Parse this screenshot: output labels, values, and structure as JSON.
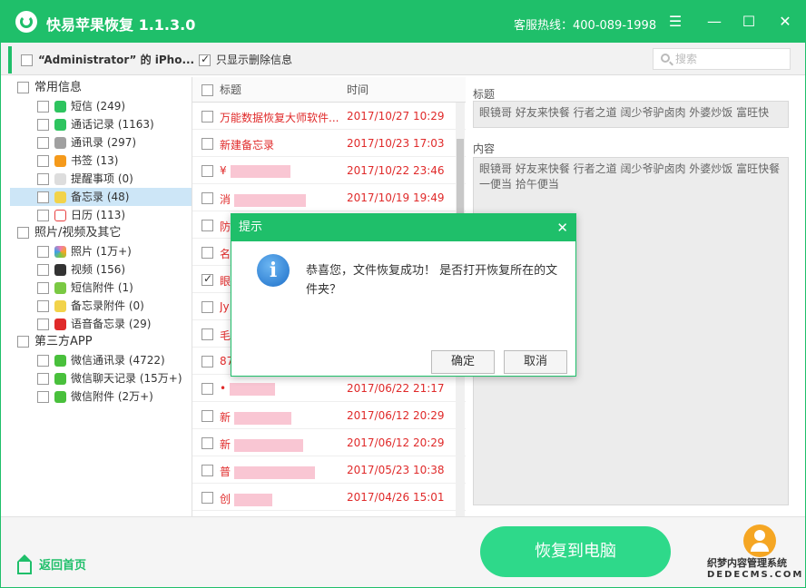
{
  "app": {
    "title": "快易苹果恢复 1.1.3.0",
    "hotline": "客服热线：400-089-1998"
  },
  "window_controls": {
    "menu": "☰",
    "minimize": "—",
    "maximize": "☐",
    "close": "✕"
  },
  "toolbar": {
    "device": "“Administrator” 的 iPho...",
    "only_deleted": "只显示删除信息",
    "search_placeholder": "搜索"
  },
  "sidebar": {
    "groups": [
      {
        "label": "常用信息",
        "items": [
          {
            "label": "短信 (249)",
            "icon": "message-icon",
            "color": "#2ec45f"
          },
          {
            "label": "通话记录 (1163)",
            "icon": "phone-icon",
            "color": "#2ec45f"
          },
          {
            "label": "通讯录 (297)",
            "icon": "contacts-icon",
            "color": "#a0a0a0"
          },
          {
            "label": "书签 (13)",
            "icon": "bookmark-icon",
            "color": "#f59a1b"
          },
          {
            "label": "提醒事项 (0)",
            "icon": "reminder-icon",
            "color": "#dddddd"
          },
          {
            "label": "备忘录 (48)",
            "icon": "notes-icon",
            "color": "#f2d34a"
          },
          {
            "label": "日历 (113)",
            "icon": "calendar-icon",
            "color": "#e84040"
          }
        ]
      },
      {
        "label": "照片/视频及其它",
        "items": [
          {
            "label": "照片 (1万+)",
            "icon": "photos-icon",
            "color": "#f07ab4"
          },
          {
            "label": "视频 (156)",
            "icon": "video-icon",
            "color": "#333333"
          },
          {
            "label": "短信附件 (1)",
            "icon": "attachment-icon",
            "color": "#7ac943"
          },
          {
            "label": "备忘录附件 (0)",
            "icon": "notes-attachment-icon",
            "color": "#f2d34a"
          },
          {
            "label": "语音备忘录 (29)",
            "icon": "voice-memo-icon",
            "color": "#e02a2a"
          }
        ]
      },
      {
        "label": "第三方APP",
        "items": [
          {
            "label": "微信通讯录 (4722)",
            "icon": "wechat-contacts-icon",
            "color": "#49c03c"
          },
          {
            "label": "微信聊天记录 (15万+)",
            "icon": "wechat-chat-icon",
            "color": "#49c03c"
          },
          {
            "label": "微信附件 (2万+)",
            "icon": "wechat-attachment-icon",
            "color": "#49c03c"
          }
        ]
      }
    ]
  },
  "list": {
    "headers": {
      "title": "标题",
      "time": "时间"
    },
    "rows": [
      {
        "title": "万能数据恢复大师软件...",
        "time": "2017/10/27 10:29",
        "checked": false
      },
      {
        "title": "新建备忘录",
        "time": "2017/10/23 17:03",
        "checked": false
      },
      {
        "title": "¥",
        "time": "2017/10/22 23:46",
        "checked": false
      },
      {
        "title": "消",
        "time": "2017/10/19 19:49",
        "checked": false
      },
      {
        "title": "防",
        "time": "",
        "checked": false
      },
      {
        "title": "名",
        "time": "",
        "checked": false
      },
      {
        "title": "眼",
        "time": "",
        "checked": true
      },
      {
        "title": "Jy",
        "time": "",
        "checked": false
      },
      {
        "title": "毛",
        "time": "",
        "checked": false
      },
      {
        "title": "87",
        "time": "",
        "checked": false
      },
      {
        "title": "•",
        "time": "2017/06/22 21:17",
        "checked": false
      },
      {
        "title": "新",
        "time": "2017/06/12 20:29",
        "checked": false
      },
      {
        "title": "新",
        "time": "2017/06/12 20:29",
        "checked": false
      },
      {
        "title": "普",
        "time": "2017/05/23 10:38",
        "checked": false
      },
      {
        "title": "创",
        "time": "2017/04/26 15:01",
        "checked": false
      }
    ]
  },
  "detail": {
    "title_label": "标题",
    "title_value": "眼镜哥  好友来快餐 行者之道  阔少爷驴卤肉  外婆炒饭  富旺快",
    "content_label": "内容",
    "content_value": "眼镜哥  好友来快餐 行者之道  阔少爷驴卤肉  外婆炒饭  富旺快餐   一便当   拾午便当"
  },
  "footer": {
    "home": "返回首页",
    "recover": "恢复到电脑",
    "watermark_line1": "织梦内容管理系统",
    "watermark_line2": "DEDECMS.COM"
  },
  "dialog": {
    "title": "提示",
    "message": "恭喜您，文件恢复成功！ 是否打开恢复所在的文件夹？",
    "ok": "确定",
    "cancel": "取消"
  }
}
